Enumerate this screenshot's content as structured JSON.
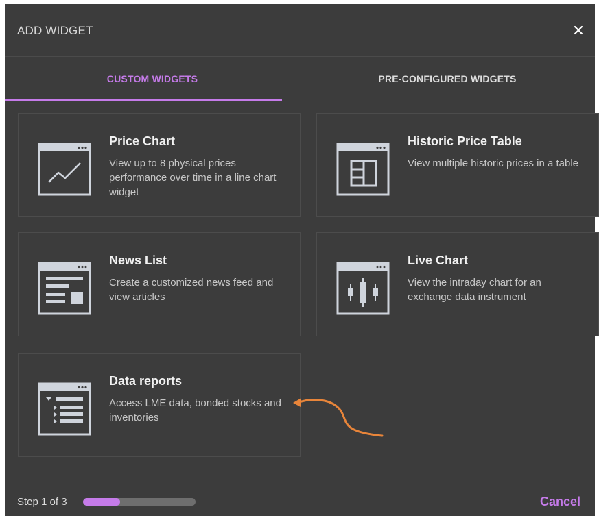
{
  "dialog": {
    "title": "ADD WIDGET",
    "close_icon": "close-icon"
  },
  "tabs": [
    {
      "label": "CUSTOM WIDGETS",
      "active": true
    },
    {
      "label": "PRE-CONFIGURED WIDGETS",
      "active": false
    }
  ],
  "widgets": [
    {
      "title": "Price Chart",
      "description": "View up to 8 physical prices performance over time in a line chart widget",
      "icon": "line-chart-icon"
    },
    {
      "title": "Historic Price Table",
      "description": "View multiple historic prices in a table",
      "icon": "table-icon"
    },
    {
      "title": "News List",
      "description": "Create a customized news feed and view articles",
      "icon": "news-list-icon"
    },
    {
      "title": "Live Chart",
      "description": "View the intraday chart for an exchange data instrument",
      "icon": "candlestick-chart-icon"
    },
    {
      "title": "Data reports",
      "description": "Access LME data, bonded stocks and inventories",
      "icon": "data-report-icon"
    }
  ],
  "footer": {
    "step_label": "Step 1 of 3",
    "progress": 0.33,
    "cancel_label": "Cancel"
  },
  "colors": {
    "accent": "#c57be9",
    "annotation_arrow": "#e8853a",
    "dialog_background": "#3c3c3c"
  }
}
